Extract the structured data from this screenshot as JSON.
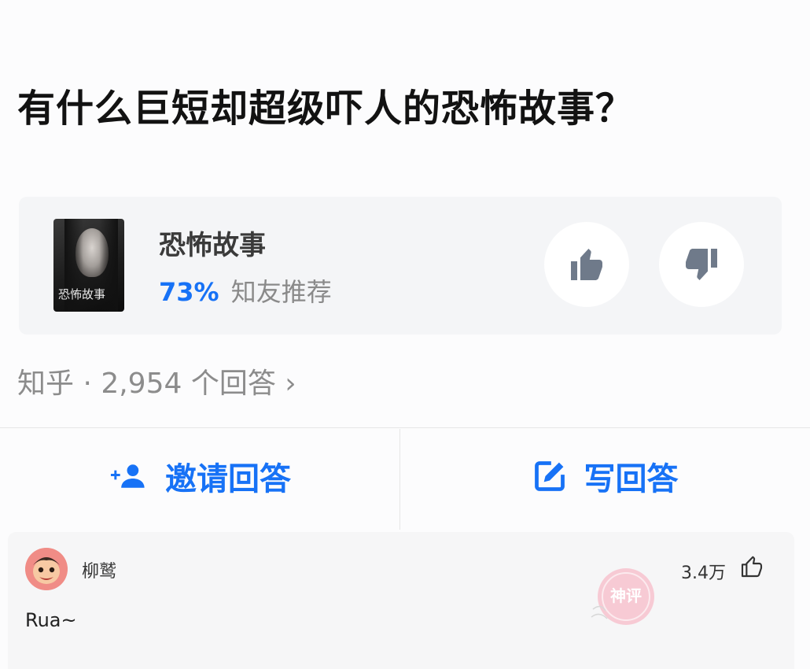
{
  "question": {
    "title": "有什么巨短却超级吓人的恐怖故事？"
  },
  "topic": {
    "cover_text": "恐怖故事",
    "name": "恐怖故事",
    "percent": "73%",
    "recommend_label": "知友推荐",
    "icons": {
      "upvote": "thumbs-up-icon",
      "downvote": "thumbs-down-icon"
    }
  },
  "meta": {
    "text": "知乎 · 2,954 个回答 ›"
  },
  "actions": {
    "invite_label": "邀请回答",
    "write_label": "写回答",
    "icons": {
      "invite": "add-user-icon",
      "write": "edit-icon"
    }
  },
  "answer": {
    "author": "柳鹫",
    "like_count": "3.4万",
    "content": "Rua~",
    "icons": {
      "like": "thumbs-up-outline-icon",
      "avatar": "avatar-cartoon-icon"
    },
    "watermark_text": "神评"
  },
  "colors": {
    "accent": "#1772f6",
    "muted_text": "#8c8c8c",
    "card_bg": "#f4f5f7"
  }
}
